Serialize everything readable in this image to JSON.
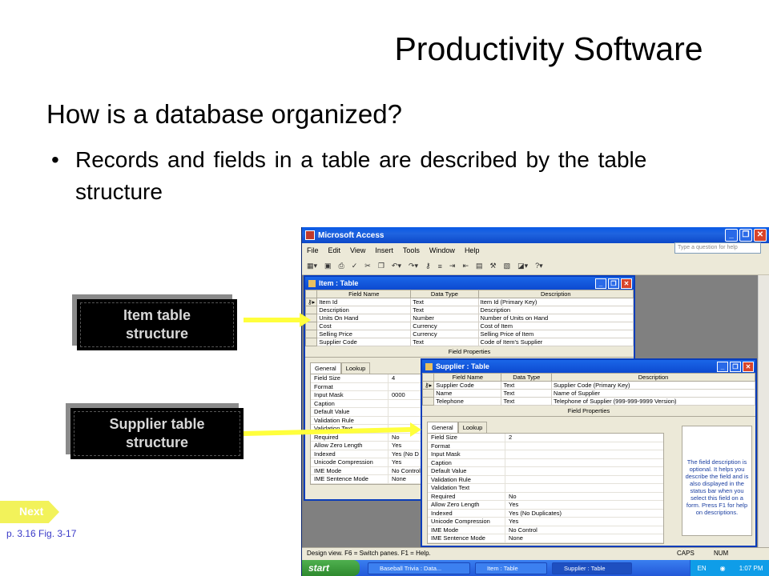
{
  "slide": {
    "title": "Productivity Software",
    "question": "How is a database organized?",
    "bullet": "Records and  fields in a table are described by the table structure",
    "bullet_mark": "•",
    "callouts": [
      {
        "line1": "Item table",
        "line2": "structure"
      },
      {
        "line1": "Supplier table",
        "line2": "structure"
      }
    ],
    "next_label": "Next",
    "page_ref": "p. 3.16 Fig. 3-17"
  },
  "access": {
    "window_title": "Microsoft Access",
    "menu": [
      "File",
      "Edit",
      "View",
      "Insert",
      "Tools",
      "Window",
      "Help"
    ],
    "search_placeholder": "Type a question for help",
    "item_window": {
      "title": "Item : Table",
      "columns": [
        "Field Name",
        "Data Type",
        "Description"
      ],
      "rows": [
        [
          "Item Id",
          "Text",
          "Item Id (Primary Key)"
        ],
        [
          "Description",
          "Text",
          "Description"
        ],
        [
          "Units On Hand",
          "Number",
          "Number of Units on Hand"
        ],
        [
          "Cost",
          "Currency",
          "Cost of Item"
        ],
        [
          "Selling Price",
          "Currency",
          "Selling Price of Item"
        ],
        [
          "Supplier Code",
          "Text",
          "Code of Item's Supplier"
        ]
      ],
      "field_properties": "Field Properties",
      "tabs": [
        "General",
        "Lookup"
      ],
      "props": [
        [
          "Field Size",
          "4"
        ],
        [
          "Format",
          ""
        ],
        [
          "Input Mask",
          "0000"
        ],
        [
          "Caption",
          ""
        ],
        [
          "Default Value",
          ""
        ],
        [
          "Validation Rule",
          ""
        ],
        [
          "Validation Text",
          ""
        ],
        [
          "Required",
          "No"
        ],
        [
          "Allow Zero Length",
          "Yes"
        ],
        [
          "Indexed",
          "Yes (No D"
        ],
        [
          "Unicode Compression",
          "Yes"
        ],
        [
          "IME Mode",
          "No Control"
        ],
        [
          "IME Sentence Mode",
          "None"
        ]
      ]
    },
    "supplier_window": {
      "title": "Supplier : Table",
      "columns": [
        "Field Name",
        "Data Type",
        "Description"
      ],
      "rows": [
        [
          "Supplier Code",
          "Text",
          "Supplier Code (Primary Key)"
        ],
        [
          "Name",
          "Text",
          "Name of Supplier"
        ],
        [
          "Telephone",
          "Text",
          "Telephone of Supplier (999-999-9999 Version)"
        ]
      ],
      "field_properties": "Field Properties",
      "tabs": [
        "General",
        "Lookup"
      ],
      "props": [
        [
          "Field Size",
          "2"
        ],
        [
          "Format",
          ""
        ],
        [
          "Input Mask",
          ""
        ],
        [
          "Caption",
          ""
        ],
        [
          "Default Value",
          ""
        ],
        [
          "Validation Rule",
          ""
        ],
        [
          "Validation Text",
          ""
        ],
        [
          "Required",
          "No"
        ],
        [
          "Allow Zero Length",
          "Yes"
        ],
        [
          "Indexed",
          "Yes (No Duplicates)"
        ],
        [
          "Unicode Compression",
          "Yes"
        ],
        [
          "IME Mode",
          "No Control"
        ],
        [
          "IME Sentence Mode",
          "None"
        ]
      ],
      "help_text": "The field description is optional.  It helps you describe the field and is also displayed in the status bar when you select this field on a form. Press F1 for help on descriptions."
    },
    "status": {
      "text": "Design view.  F6 = Switch panes.  F1 = Help.",
      "caps": "CAPS",
      "num": "NUM"
    },
    "taskbar": {
      "start": "start",
      "tasks": [
        "Baseball Trivia : Data...",
        "Item : Table",
        "Supplier : Table"
      ],
      "lang": "EN",
      "time": "1:07 PM"
    }
  },
  "colors": {
    "arrow": "#ffff3c",
    "title_bar": "#0a5ae6",
    "next_tab": "#f2f25a"
  }
}
